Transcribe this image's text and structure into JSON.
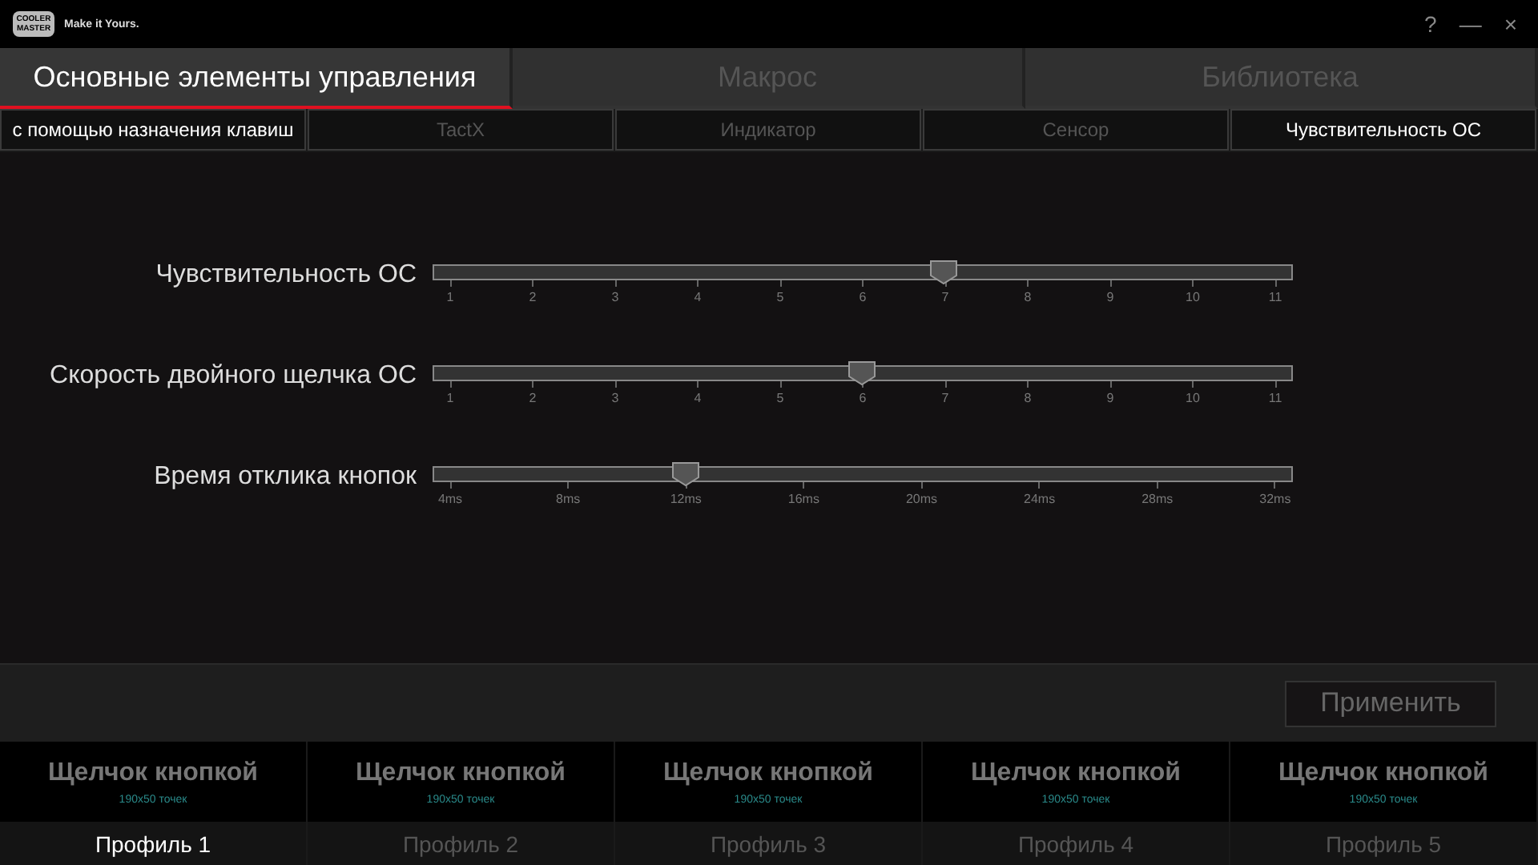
{
  "logo": {
    "brand": "COOLER MASTER",
    "tagline": "Make it Yours."
  },
  "window_controls": [
    "?",
    "—",
    "×"
  ],
  "tabs": [
    {
      "label": "Основные элементы управления",
      "selected": true
    },
    {
      "label": "Макрос",
      "selected": false
    },
    {
      "label": "Библиотека",
      "selected": false
    }
  ],
  "subtabs": [
    {
      "label": "с помощью назначения клавиш",
      "disabled": false
    },
    {
      "label": "TactX",
      "disabled": true
    },
    {
      "label": "Индикатор",
      "disabled": true
    },
    {
      "label": "Сенсор",
      "disabled": true
    },
    {
      "label": "Чувствительность ОС",
      "disabled": false
    }
  ],
  "sliders": [
    {
      "label": "Чувствительность ОС",
      "level": 0.6,
      "ticks": [
        "1",
        "2",
        "3",
        "4",
        "5",
        "6",
        "7",
        "8",
        "9",
        "10",
        "11"
      ]
    },
    {
      "label": "Скорость двойного щелчка ОС",
      "level": 0.5,
      "ticks": [
        "1",
        "2",
        "3",
        "4",
        "5",
        "6",
        "7",
        "8",
        "9",
        "10",
        "11"
      ]
    },
    {
      "label": "Время отклика кнопок",
      "level": 0.2857,
      "ticks": [
        "4ms",
        "8ms",
        "12ms",
        "16ms",
        "20ms",
        "24ms",
        "28ms",
        "32ms"
      ]
    }
  ],
  "apply_button": {
    "label": "Применить",
    "disabled": true
  },
  "profiles": [
    {
      "title": "Щелчок кнопкой",
      "size": "190x50 точек",
      "label": "Профиль 1",
      "selected": true
    },
    {
      "title": "Щелчок кнопкой",
      "size": "190x50 точек",
      "label": "Профиль 2",
      "selected": false
    },
    {
      "title": "Щелчок кнопкой",
      "size": "190x50 точек",
      "label": "Профиль 3",
      "selected": false
    },
    {
      "title": "Щелчок кнопкой",
      "size": "190x50 точек",
      "label": "Профиль 4",
      "selected": false
    },
    {
      "title": "Щелчок кнопкой",
      "size": "190x50 точек",
      "label": "Профиль 5",
      "selected": false
    }
  ]
}
